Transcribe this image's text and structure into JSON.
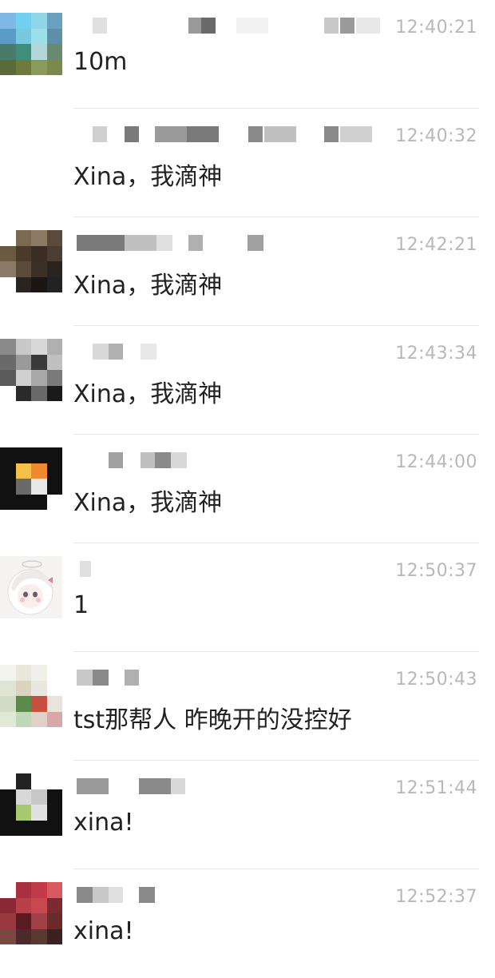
{
  "messages": [
    {
      "time": "12:40:21",
      "text": "10m"
    },
    {
      "time": "12:40:32",
      "text": "Xina，我滴神"
    },
    {
      "time": "12:42:21",
      "text": "Xina，我滴神"
    },
    {
      "time": "12:43:34",
      "text": "Xina，我滴神"
    },
    {
      "time": "12:44:00",
      "text": "Xina，我滴神"
    },
    {
      "time": "12:50:37",
      "text": "1"
    },
    {
      "time": "12:50:43",
      "text": "tst那帮人 昨晚开的没控好"
    },
    {
      "time": "12:51:44",
      "text": "xina!"
    },
    {
      "time": "12:52:37",
      "text": "xina!"
    }
  ],
  "colors": {
    "time": "#b8b8b8",
    "message_text": "#222222",
    "divider": "#e6e6e6"
  }
}
